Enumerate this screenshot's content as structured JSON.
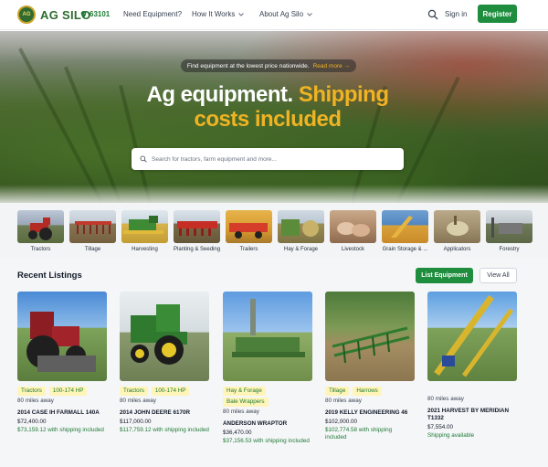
{
  "header": {
    "logo_text": "AG SILO",
    "zip": "63101",
    "nav": [
      {
        "label": "Need Equipment?"
      },
      {
        "label": "How It Works"
      },
      {
        "label": "About Ag Silo"
      }
    ],
    "signin_label": "Sign in",
    "register_label": "Register"
  },
  "hero": {
    "banner_text": "Find equipment at the lowest price nationwide.",
    "banner_link": "Read more →",
    "title_white": "Ag equipment.",
    "title_gold_1": "Shipping",
    "title_gold_2": "costs included",
    "search_placeholder": "Search for tractors, farm equipment and more..."
  },
  "categories": [
    {
      "label": "Tractors"
    },
    {
      "label": "Tillage"
    },
    {
      "label": "Harvesting"
    },
    {
      "label": "Planting & Seeding"
    },
    {
      "label": "Trailers"
    },
    {
      "label": "Hay & Forage"
    },
    {
      "label": "Livestock"
    },
    {
      "label": "Grain Storage & ..."
    },
    {
      "label": "Applicators"
    },
    {
      "label": "Forestry"
    }
  ],
  "listings": {
    "title": "Recent Listings",
    "list_button": "List Equipment",
    "view_all": "View All",
    "cards": [
      {
        "tags": [
          "Tractors",
          "100-174 HP"
        ],
        "distance": "80 miles away",
        "title": "2014 CASE IH FARMALL 140A",
        "price": "$72,400.00",
        "shipping": "$73,159.12 with shipping included"
      },
      {
        "tags": [
          "Tractors",
          "100-174 HP"
        ],
        "distance": "80 miles away",
        "title": "2014 JOHN DEERE 6170R",
        "price": "$117,000.00",
        "shipping": "$117,759.12 with shipping included"
      },
      {
        "tags": [
          "Hay & Forage",
          "Bale Wrappers"
        ],
        "distance": "80 miles away",
        "title": "ANDERSON WRAPTOR",
        "price": "$36,470.00",
        "shipping": "$37,156.53 with shipping included"
      },
      {
        "tags": [
          "Tillage",
          "Harrows"
        ],
        "distance": "80 miles away",
        "title": "2019 KELLY ENGINEERING 46",
        "price": "$102,000.00",
        "shipping": "$102,774.58 with shipping included"
      },
      {
        "tags": [],
        "distance": "80 miles away",
        "title": "2021 HARVEST BY MERIDIAN T1332",
        "price": "$7,554.00",
        "shipping": "Shipping available"
      }
    ]
  },
  "colors": {
    "brand_green": "#1e8e3e",
    "gold": "#f0b323",
    "tag_bg": "#fff5b8"
  }
}
